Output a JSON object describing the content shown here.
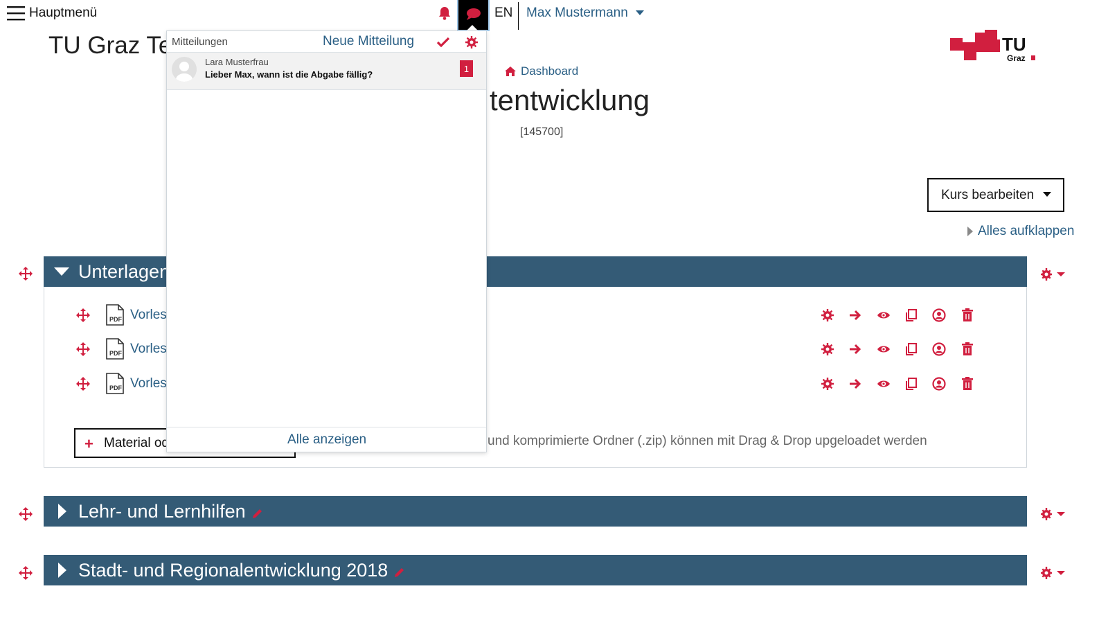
{
  "topbar": {
    "menu_label": "Hauptmenü",
    "language": "EN",
    "user_name": "Max Mustermann"
  },
  "site_title": "TU Graz Te",
  "logo": {
    "text_top": "TU",
    "text_bottom": "Graz"
  },
  "breadcrumb": {
    "dashboard": "Dashboard"
  },
  "course": {
    "title": "tentwicklung",
    "id": "[145700]",
    "edit_button": "Kurs bearbeiten",
    "expand_all": "Alles aufklappen"
  },
  "sections": [
    {
      "title": "Unterlagen",
      "expanded": true,
      "items": [
        {
          "label": "Vorles",
          "icon": "pdf-icon"
        },
        {
          "label": "Vorles",
          "icon": "pdf-icon"
        },
        {
          "label": "Vorles",
          "icon": "pdf-icon"
        }
      ],
      "add_button": "Material od",
      "dropzone_hint": "und komprimierte Ordner (.zip) können mit Drag & Drop upgeloadet werden"
    },
    {
      "title": "Lehr- und Lernhilfen",
      "expanded": false
    },
    {
      "title": "Stadt- und Regionalentwicklung 2018",
      "expanded": false
    }
  ],
  "item_actions": [
    "gear-icon",
    "arrow-right-icon",
    "eye-icon",
    "copy-icon",
    "user-circle-icon",
    "trash-icon"
  ],
  "messages_popover": {
    "title": "Mitteilungen",
    "new_message": "Neue Mitteilung",
    "items": [
      {
        "sender": "Lara Musterfrau",
        "text": "Lieber Max, wann ist die Abgabe fällig?",
        "unread_count": "1"
      }
    ],
    "view_all": "Alle anzeigen"
  },
  "colors": {
    "accent": "#d11f3f",
    "section_bar": "#345b76",
    "link": "#2a5f85"
  }
}
